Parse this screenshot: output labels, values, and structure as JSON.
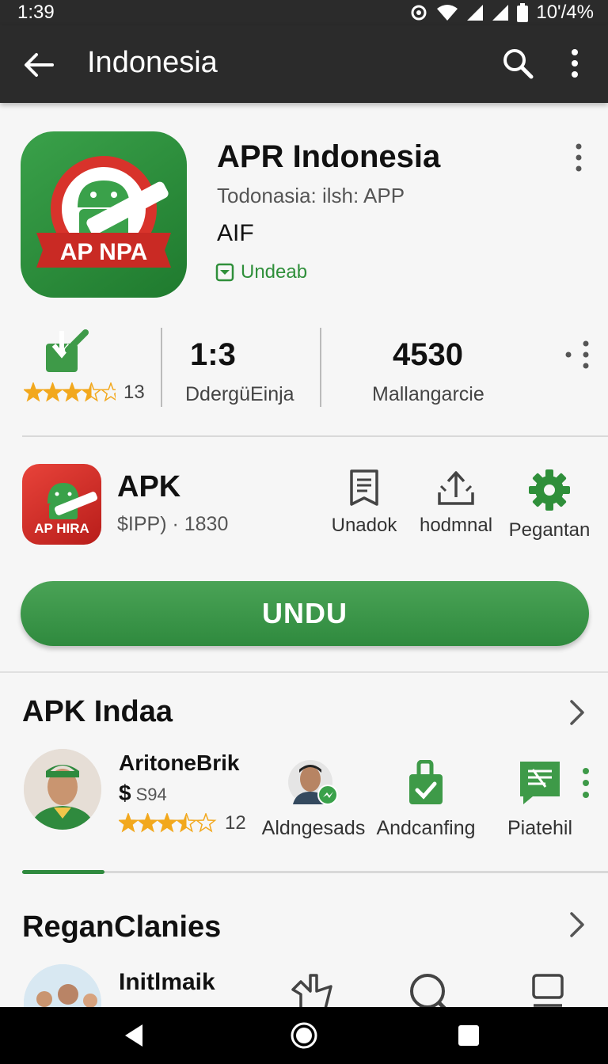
{
  "status_bar": {
    "time": "1:39",
    "battery": "10'/4%"
  },
  "app_bar": {
    "title": "Indonesia",
    "icons": [
      "arrow-back-icon",
      "search-icon",
      "more-vert-icon"
    ]
  },
  "app": {
    "name": "APR Indonesia",
    "subtitle": "Todonasia: ilsh: APP",
    "developer": "AIF",
    "badge": "Undeab",
    "icon_text": "AP NPA"
  },
  "stats": {
    "rating_count": "13",
    "rating_stars": 3.5,
    "stat2_value": "1:3",
    "stat2_label": "DdergüEinja",
    "stat3_value": "4530",
    "stat3_label": "Mallangarcie"
  },
  "apk": {
    "title": "APK",
    "size": "$IPP) · 1830",
    "icon_text": "AP HIRA",
    "actions": [
      {
        "label": "Unadok",
        "icon": "document-icon"
      },
      {
        "label": "hodmnal",
        "icon": "share-icon"
      },
      {
        "label": "Pegantan",
        "icon": "gear-icon"
      }
    ]
  },
  "install_button": "UNDU",
  "section1": {
    "title": "APK Indaa",
    "featured": {
      "name": "AritoneBrik",
      "price_symbol": "$",
      "price": "S94",
      "rating_count": "12",
      "rating_stars": 3.5
    },
    "items": [
      {
        "label": "Aldngesads",
        "icon": "person-messenger-icon"
      },
      {
        "label": "Andcanfing",
        "icon": "lock-check-icon"
      },
      {
        "label": "Piatehil",
        "icon": "chat-list-icon"
      }
    ],
    "scroll_progress": 0.14
  },
  "section2": {
    "title": "ReganClanies",
    "first_item": "Initlmaik"
  },
  "colors": {
    "accent": "#2f8a3e",
    "star": "#f2a81d",
    "appbar": "#2b2b2b"
  }
}
